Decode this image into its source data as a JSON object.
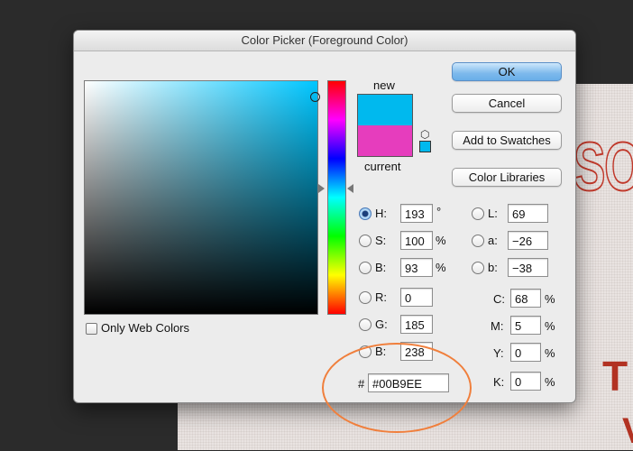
{
  "dialog": {
    "title": "Color Picker (Foreground Color)"
  },
  "swatch": {
    "new_label": "new",
    "current_label": "current",
    "new_color": "#00B9EE",
    "current_color": "#E63DBD"
  },
  "buttons": {
    "ok": "OK",
    "cancel": "Cancel",
    "add_to_swatches": "Add to Swatches",
    "color_libraries": "Color Libraries"
  },
  "only_web_colors": {
    "label": "Only Web Colors",
    "checked": false
  },
  "hsb": {
    "h": {
      "label": "H:",
      "value": "193",
      "unit": "°",
      "selected": true
    },
    "s": {
      "label": "S:",
      "value": "100",
      "unit": "%"
    },
    "b": {
      "label": "B:",
      "value": "93",
      "unit": "%"
    }
  },
  "rgb": {
    "r": {
      "label": "R:",
      "value": "0"
    },
    "g": {
      "label": "G:",
      "value": "185"
    },
    "b": {
      "label": "B:",
      "value": "238"
    }
  },
  "lab": {
    "l": {
      "label": "L:",
      "value": "69"
    },
    "a": {
      "label": "a:",
      "value": "−26"
    },
    "b": {
      "label": "b:",
      "value": "−38"
    }
  },
  "cmyk": {
    "c": {
      "label": "C:",
      "value": "68",
      "unit": "%"
    },
    "m": {
      "label": "M:",
      "value": "5",
      "unit": "%"
    },
    "y": {
      "label": "Y:",
      "value": "0",
      "unit": "%"
    },
    "k": {
      "label": "K:",
      "value": "0",
      "unit": "%"
    }
  },
  "hex": {
    "label": "#",
    "value": "#00B9EE"
  },
  "icons": {
    "gamut_cube": "cube-icon"
  },
  "colors": {
    "annotation": "#F07F3C",
    "background_text": "#B23222"
  }
}
